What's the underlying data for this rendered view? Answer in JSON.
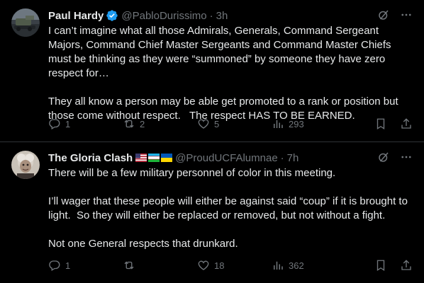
{
  "tweets": [
    {
      "author_name": "Paul Hardy",
      "handle": "@PabloDurissimo",
      "separator": "·",
      "time": "3h",
      "verified": true,
      "text": "I can’t imagine what all those Admirals, Generals, Command Sergeant Majors, Command Chief Master Sergeants and Command Master Chiefs must be thinking as they were “summoned” by someone they have zero respect for…\n\nThey all know a person may be able get promoted to a rank or position but those come without respect.   The respect HAS TO BE EARNED.",
      "replies": "1",
      "reposts": "2",
      "likes": "5",
      "views": "293"
    },
    {
      "author_name": "The Gloria Clash",
      "handle": "@ProudUCFAlumnae",
      "separator": "·",
      "time": "7h",
      "verified": false,
      "flags": [
        "us-flag",
        "uzbekistan-flag",
        "ukraine-flag"
      ],
      "text": "There will be a few military personnel of color in this meeting.\n\nI’ll wager that these people will either be against said “coup” if it is brought to light.  So they will either be replaced or removed, but not without a fight.\n\nNot one General respects that drunkard.",
      "replies": "1",
      "reposts": "",
      "likes": "18",
      "views": "362"
    }
  ],
  "colors": {
    "background": "#000000",
    "text": "#e7e9ea",
    "muted": "#71767b",
    "verified": "#1d9bf0",
    "divider": "#2f3336"
  }
}
